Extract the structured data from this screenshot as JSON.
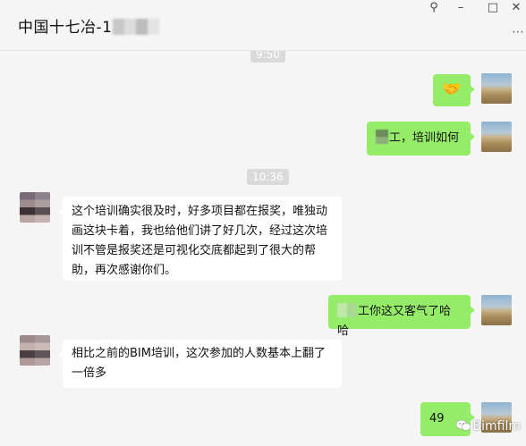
{
  "window": {
    "title_visible": "中国十七冶-1",
    "controls": {
      "pin": "⚲",
      "minimize": "–",
      "maximize": "□",
      "close": "✕"
    },
    "more_menu": "⋯"
  },
  "chat": {
    "timestamps": [
      "9:50",
      "10:36"
    ],
    "messages": [
      {
        "sender": "me",
        "text": "🤝"
      },
      {
        "sender": "me",
        "text": "工，培训如何"
      },
      {
        "sender": "them",
        "text": "这个培训确实很及时，好多项目都在报奖，唯独动画这块卡着，我也给他们讲了好几次，经过这次培训不管是报奖还是可视化交底都起到了很大的帮助，再次感谢你们。"
      },
      {
        "sender": "me",
        "text": "工你这又客气了哈哈"
      },
      {
        "sender": "them",
        "text": "相比之前的BIM培训，这次参加的人数基本上翻了一倍多"
      },
      {
        "sender": "me",
        "text": "49"
      }
    ]
  },
  "watermark": {
    "text": "Bimfilm"
  },
  "colors": {
    "background": "#f5f5f5",
    "bubble_me": "#95ec69",
    "bubble_them": "#ffffff",
    "timestamp_bg": "#dadada"
  },
  "icons": {
    "handshake": "handshake-emoji",
    "pin": "pin-icon",
    "minimize": "minimize-icon",
    "maximize": "maximize-icon",
    "close": "close-icon",
    "more": "more-options-icon"
  }
}
